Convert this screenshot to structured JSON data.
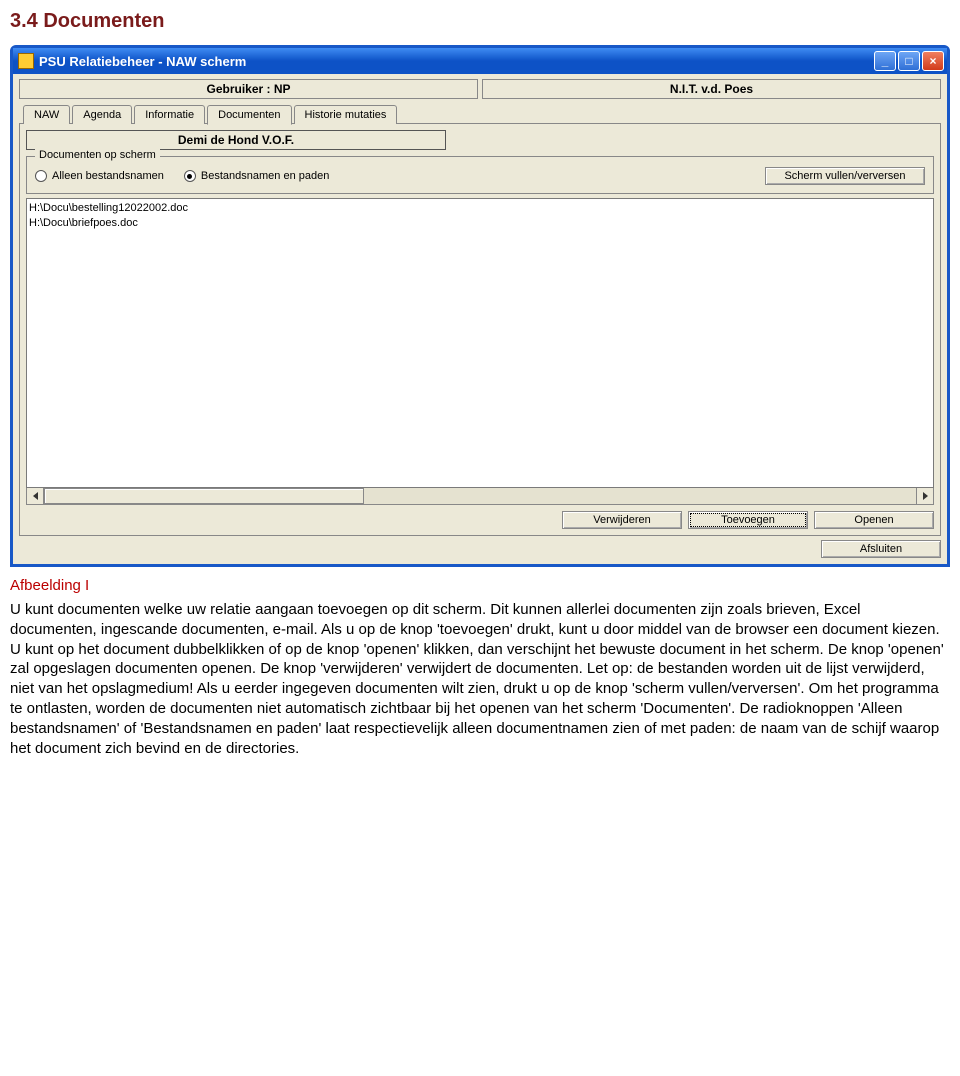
{
  "doc": {
    "heading": "3.4 Documenten",
    "caption": "Afbeelding I",
    "body": "U kunt documenten welke uw relatie aangaan toevoegen op dit scherm. Dit kunnen allerlei documenten zijn zoals brieven, Excel documenten, ingescande documenten, e-mail. Als u op de knop 'toevoegen' drukt, kunt u door middel van de browser een document kiezen. U kunt op het document dubbelklikken of op de knop 'openen' klikken, dan verschijnt het bewuste document in het scherm. De knop 'openen' zal opgeslagen documenten openen. De knop 'verwijderen' verwijdert de documenten. Let op: de bestanden worden uit de lijst verwijderd, niet van het opslagmedium! Als u eerder ingegeven documenten wilt zien, drukt u op de knop 'scherm vullen/verversen'. Om het programma te ontlasten, worden de documenten niet automatisch zichtbaar bij het openen van het scherm 'Documenten'. De radioknoppen 'Alleen bestandsnamen' of 'Bestandsnamen en paden' laat respectievelijk alleen documentnamen zien of met paden: de naam van de schijf waarop het document zich bevind en de directories."
  },
  "window": {
    "title": "PSU Relatiebeheer - NAW scherm",
    "header": {
      "user_label": "Gebruiker : NP",
      "org_label": "N.I.T. v.d. Poes"
    },
    "tabs": [
      "NAW",
      "Agenda",
      "Informatie",
      "Documenten",
      "Historie mutaties"
    ],
    "active_tab_index": 3,
    "relation_name": "Demi de Hond V.O.F.",
    "group": {
      "legend": "Documenten op scherm",
      "radios": [
        {
          "label": "Alleen bestandsnamen",
          "checked": false
        },
        {
          "label": "Bestandsnamen en paden",
          "checked": true
        }
      ],
      "refresh": "Scherm vullen/verversen"
    },
    "documents": [
      "H:\\Docu\\bestelling12022002.doc",
      "H:\\Docu\\briefpoes.doc"
    ],
    "buttons": {
      "delete": "Verwijderen",
      "add": "Toevoegen",
      "open": "Openen",
      "close": "Afsluiten"
    }
  }
}
